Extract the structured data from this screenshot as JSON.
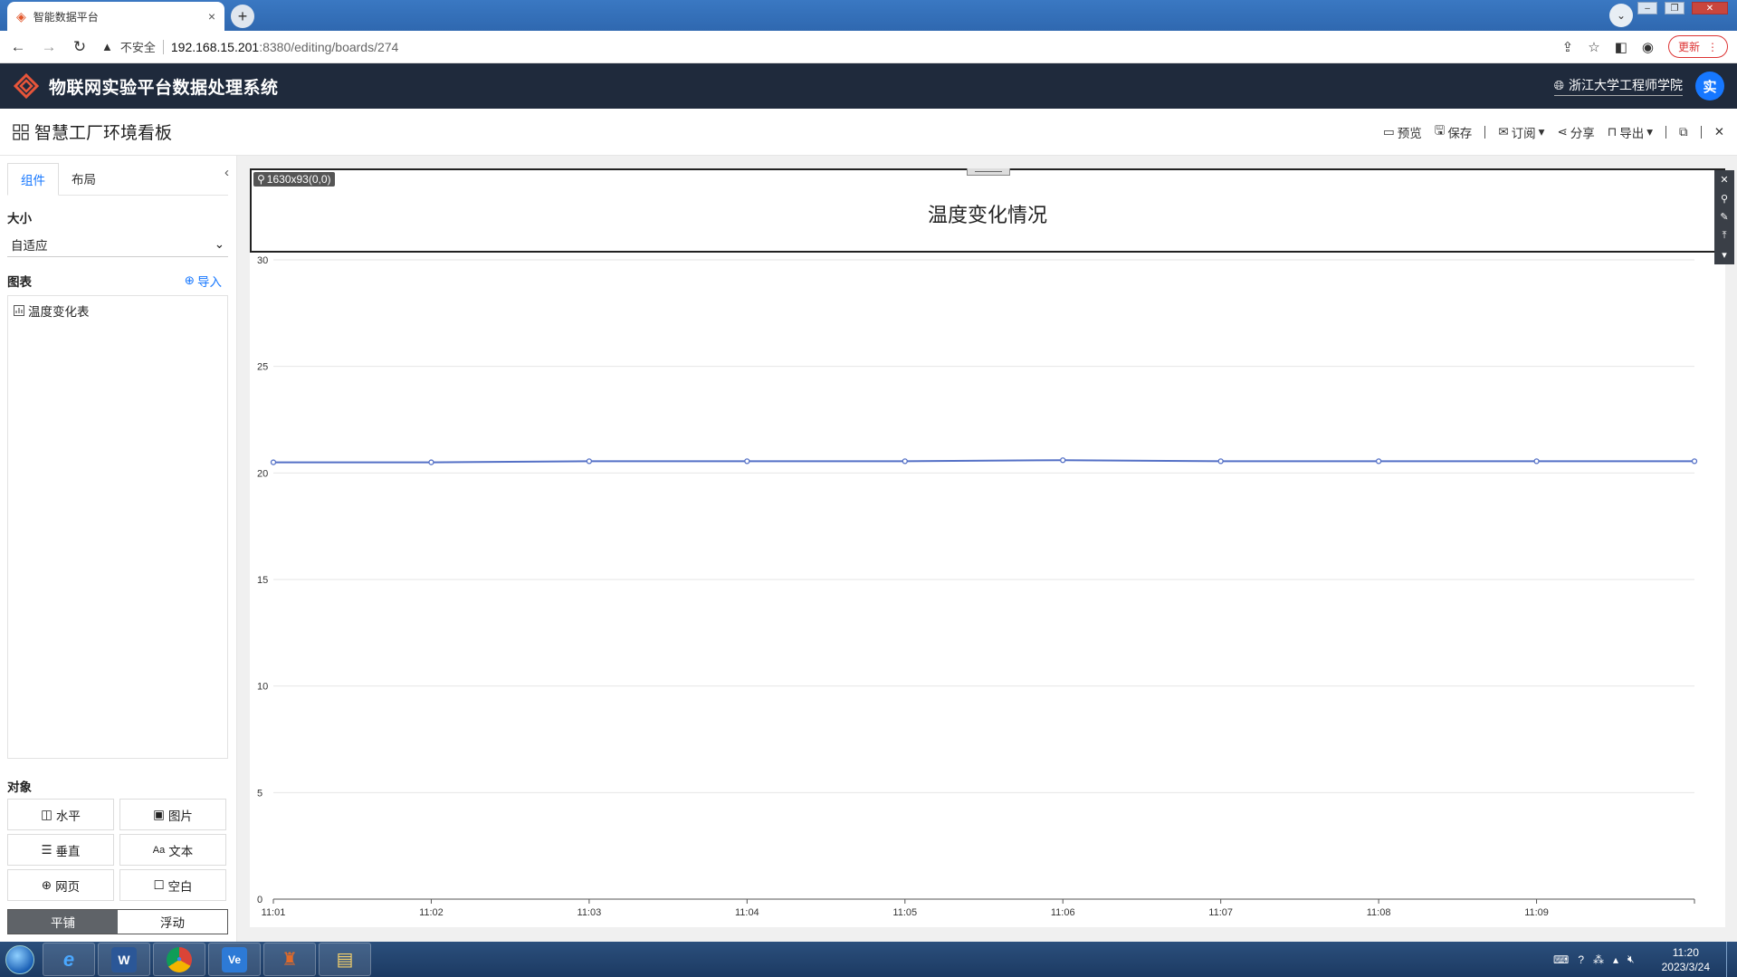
{
  "browser": {
    "tab_title": "智能数据平台",
    "tab_close": "×",
    "new_tab": "+",
    "tab_search": "⌄",
    "back": "←",
    "forward": "→",
    "reload": "↻",
    "security_warning": "▲",
    "security_label": "不安全",
    "url_host": "192.168.15.201",
    "url_path": ":8380/editing/boards/274",
    "update_label": "更新",
    "menu": "⋮"
  },
  "app": {
    "title": "物联网实验平台数据处理系统",
    "org_name": "浙江大学工程师学院",
    "avatar_text": "实"
  },
  "board": {
    "title": "智慧工厂环境看板",
    "toolbar": {
      "preview": "预览",
      "save": "保存",
      "subscribe": "订阅",
      "share": "分享",
      "export": "导出"
    }
  },
  "left_panel": {
    "tabs": [
      "组件",
      "布局"
    ],
    "size_label": "大小",
    "size_value": "自适应",
    "charts_label": "图表",
    "import_label": "导入",
    "chart_items": [
      "温度变化表"
    ],
    "objects_label": "对象",
    "objects": [
      "水平",
      "图片",
      "垂直",
      "文本",
      "网页",
      "空白"
    ],
    "text_icon": "Aa",
    "modes": [
      "平铺",
      "浮动"
    ]
  },
  "widget": {
    "dimension_tag": "1630x93(0,0)",
    "title": "温度变化情况"
  },
  "chart_data": {
    "type": "line",
    "title": "",
    "xlabel": "",
    "ylabel": "",
    "x": [
      "11:01",
      "11:02",
      "11:03",
      "11:04",
      "11:05",
      "11:06",
      "11:07",
      "11:08",
      "11:09",
      ""
    ],
    "series": [
      {
        "values": [
          20.5,
          20.5,
          20.55,
          20.55,
          20.55,
          20.6,
          20.55,
          20.55,
          20.55,
          20.55
        ]
      }
    ],
    "ylim": [
      0,
      30
    ],
    "yticks": [
      "0",
      "5",
      "10",
      "15",
      "20",
      "25",
      "30"
    ],
    "grid": true,
    "colors": {
      "line": "#5470c6"
    }
  },
  "taskbar": {
    "apps": [
      "e",
      "W",
      "●",
      "Ve",
      "♜",
      "▤"
    ],
    "time": "11:20",
    "date": "2023/3/24"
  }
}
